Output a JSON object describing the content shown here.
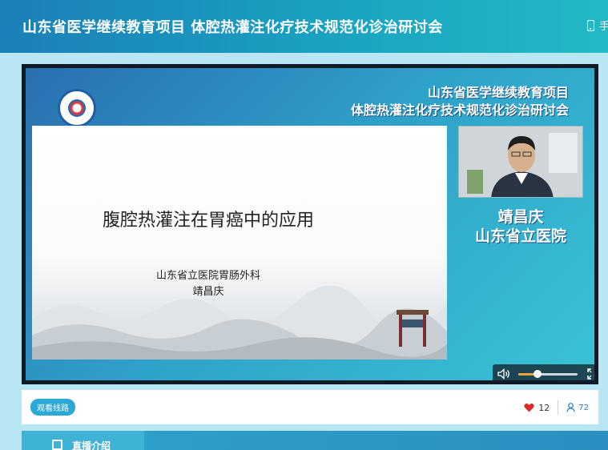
{
  "header": {
    "title": "山东省医学继续教育项目 体腔热灌注化疗技术规范化诊治研讨会",
    "phone_watch_label": "手"
  },
  "video": {
    "conference_title_line1": "山东省医学继续教育项目",
    "conference_title_line2": "体腔热灌注化疗技术规范化诊治研讨会",
    "slide": {
      "title": "腹腔热灌注在胃癌中的应用",
      "department": "山东省立医院胃肠外科",
      "presenter": "靖昌庆"
    },
    "speaker": {
      "name": "靖昌庆",
      "hospital": "山东省立医院"
    },
    "volume_level": 0.32
  },
  "info": {
    "route_button_label": "观看线路",
    "likes": "12",
    "viewers": "72"
  },
  "tabs": {
    "active_label": "直播介绍"
  },
  "colors": {
    "header_gradient_start": "#1b7fb8",
    "accent": "#2aa8d6",
    "like_red": "#e02b2b",
    "page_bg": "#b9e6f3"
  }
}
